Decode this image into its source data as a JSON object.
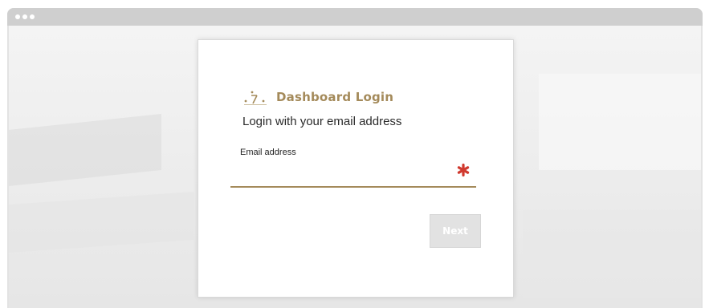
{
  "login": {
    "title": "Dashboard Login",
    "subtitle": "Login with your email address",
    "email_label": "Email address",
    "email_value": "",
    "email_placeholder": "",
    "next_label": "Next"
  },
  "icons": {
    "logo": "dashboard-gauge-icon",
    "required": "asterisk-icon",
    "window_controls": "window-dots-icon"
  },
  "colors": {
    "brand": "#a48a5a",
    "required": "#d03a2f",
    "button_disabled": "#e2e2e2"
  }
}
